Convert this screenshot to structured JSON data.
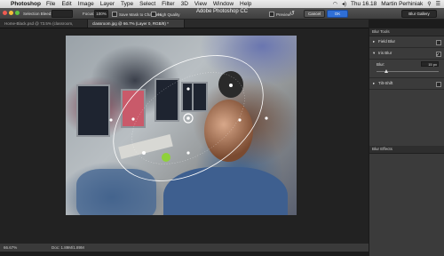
{
  "menubar": {
    "app_name": "Photoshop",
    "items": [
      "File",
      "Edit",
      "Image",
      "Layer",
      "Type",
      "Select",
      "Filter",
      "3D",
      "View",
      "Window",
      "Help"
    ],
    "time": "Thu 16.18",
    "user": "Martin Perhiniak"
  },
  "window": {
    "title": "Adobe Photoshop CC"
  },
  "options": {
    "selection_bleed_label": "Selection Bleed:",
    "focus_label": "Focus:",
    "focus_value": "100%",
    "save_mask_label": "Save Mask to Channels",
    "high_quality_label": "High Quality",
    "preview_label": "Preview",
    "cancel_label": "Cancel",
    "ok_label": "OK",
    "workspace_label": "Blur Gallery"
  },
  "tabs": [
    {
      "label": "Home-Black.psd @ 73.5% (classroom, RGB/8#) *",
      "active": false
    },
    {
      "label": "classroom.jpg @ 66.7% (Layer 0, RGB/8) *",
      "active": true
    }
  ],
  "status": {
    "zoom": "66.67%",
    "doc": "Doc: 1.89M/1.89M"
  },
  "blur_tools": {
    "header": "Blur Tools",
    "sections": [
      {
        "label": "Field Blur",
        "expanded": false,
        "checked": false
      },
      {
        "label": "Iris Blur",
        "expanded": true,
        "checked": true
      },
      {
        "label": "Tilt-Shift",
        "expanded": false,
        "checked": false
      }
    ],
    "blur_label": "Blur:",
    "blur_value": "15 px",
    "blur_fraction": 0.15
  },
  "blur_effects": {
    "header": "Blur Effects"
  },
  "colors": {
    "ok_button": "#2f6fd6",
    "accent_ring": "#ffffff"
  }
}
